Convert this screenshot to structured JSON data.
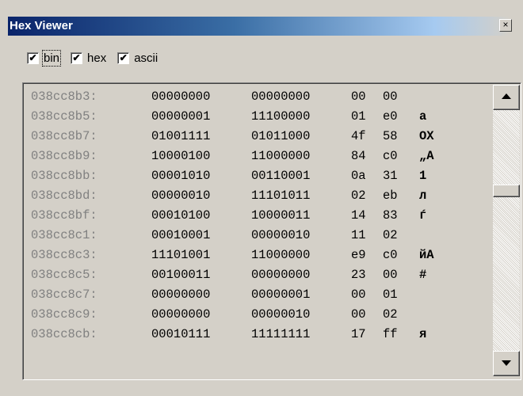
{
  "window": {
    "title": "Hex Viewer",
    "close_glyph": "×"
  },
  "options": [
    {
      "label": "bin",
      "checked": true,
      "focused": true
    },
    {
      "label": "hex",
      "checked": true,
      "focused": false
    },
    {
      "label": "ascii",
      "checked": true,
      "focused": false
    }
  ],
  "check_glyph": "✔",
  "rows": [
    {
      "addr": "038cc8b3:",
      "bin1": "00000000",
      "bin2": "00000000",
      "hex1": "00",
      "hex2": "00",
      "ascii": ""
    },
    {
      "addr": "038cc8b5:",
      "bin1": "00000001",
      "bin2": "11100000",
      "hex1": "01",
      "hex2": "e0",
      "ascii": "а"
    },
    {
      "addr": "038cc8b7:",
      "bin1": "01001111",
      "bin2": "01011000",
      "hex1": "4f",
      "hex2": "58",
      "ascii": "OX"
    },
    {
      "addr": "038cc8b9:",
      "bin1": "10000100",
      "bin2": "11000000",
      "hex1": "84",
      "hex2": "c0",
      "ascii": "„А"
    },
    {
      "addr": "038cc8bb:",
      "bin1": "00001010",
      "bin2": "00110001",
      "hex1": "0a",
      "hex2": "31",
      "ascii": "1"
    },
    {
      "addr": "038cc8bd:",
      "bin1": "00000010",
      "bin2": "11101011",
      "hex1": "02",
      "hex2": "eb",
      "ascii": "л"
    },
    {
      "addr": "038cc8bf:",
      "bin1": "00010100",
      "bin2": "10000011",
      "hex1": "14",
      "hex2": "83",
      "ascii": "ѓ"
    },
    {
      "addr": "038cc8c1:",
      "bin1": "00010001",
      "bin2": "00000010",
      "hex1": "11",
      "hex2": "02",
      "ascii": ""
    },
    {
      "addr": "038cc8c3:",
      "bin1": "11101001",
      "bin2": "11000000",
      "hex1": "e9",
      "hex2": "c0",
      "ascii": "йА"
    },
    {
      "addr": "038cc8c5:",
      "bin1": "00100011",
      "bin2": "00000000",
      "hex1": "23",
      "hex2": "00",
      "ascii": "#"
    },
    {
      "addr": "038cc8c7:",
      "bin1": "00000000",
      "bin2": "00000001",
      "hex1": "00",
      "hex2": "01",
      "ascii": ""
    },
    {
      "addr": "038cc8c9:",
      "bin1": "00000000",
      "bin2": "00000010",
      "hex1": "00",
      "hex2": "02",
      "ascii": ""
    },
    {
      "addr": "038cc8cb:",
      "bin1": "00010111",
      "bin2": "11111111",
      "hex1": "17",
      "hex2": "ff",
      "ascii": "я"
    }
  ],
  "colors": {
    "titlebar_start": "#0a246a",
    "titlebar_end": "#a6caf0",
    "face": "#d4d0c8",
    "address_text": "#808080"
  },
  "icons": {
    "close": "close-icon",
    "scroll_up": "arrow-up-icon",
    "scroll_down": "arrow-down-icon",
    "check": "checkmark-icon"
  }
}
